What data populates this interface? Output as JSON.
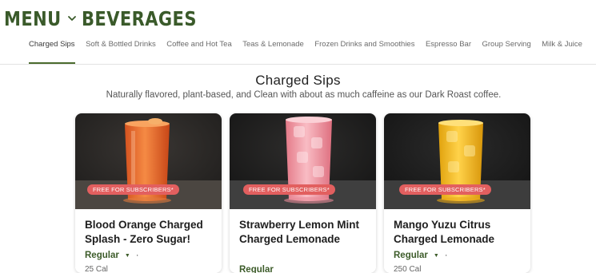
{
  "brand": {
    "menu_label": "MENU",
    "category_label": "BEVERAGES",
    "color": "#3a5a2a"
  },
  "tabs": [
    {
      "label": "Charged Sips",
      "active": true
    },
    {
      "label": "Soft & Bottled Drinks"
    },
    {
      "label": "Coffee and Hot Tea"
    },
    {
      "label": "Teas & Lemonade"
    },
    {
      "label": "Frozen Drinks and Smoothies"
    },
    {
      "label": "Espresso Bar"
    },
    {
      "label": "Group Serving"
    },
    {
      "label": "Milk & Juice"
    }
  ],
  "section": {
    "title": "Charged Sips",
    "subtitle": "Naturally flavored, plant-based, and Clean with about as much caffeine as our Dark Roast coffee."
  },
  "products": [
    {
      "name": "Blood Orange Charged Splash - Zero Sugar!",
      "badge": "FREE FOR SUBSCRIBERS*",
      "size": "Regular",
      "meta": "25 Cal",
      "drink_color": "#f07a3a"
    },
    {
      "name": "Strawberry Lemon Mint Charged Lemonade",
      "badge": "FREE FOR SUBSCRIBERS*",
      "size": "Regular",
      "meta": "",
      "drink_color": "#f3a2ad"
    },
    {
      "name": "Mango Yuzu Citrus Charged Lemonade",
      "badge": "FREE FOR SUBSCRIBERS*",
      "size": "Regular",
      "meta": "250 Cal",
      "drink_color": "#f6c22a"
    }
  ],
  "colors": {
    "accent": "#4b6b2e",
    "badge": "#e25f5f"
  }
}
